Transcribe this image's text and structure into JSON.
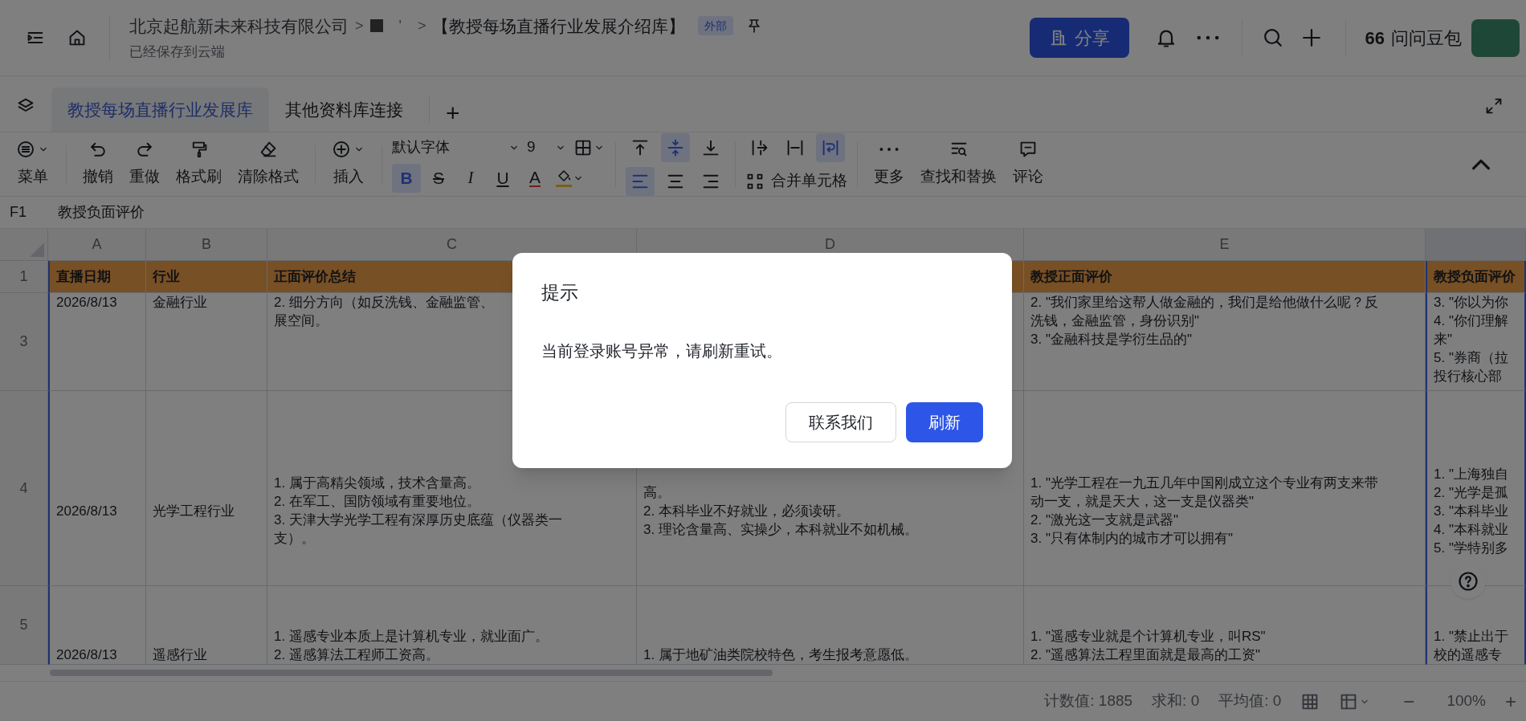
{
  "header": {
    "org": "北京起航新未来科技有限公司",
    "separators": [
      ">",
      ">"
    ],
    "hidden_segment": "'",
    "doc_title": "【教授每场直播行业发展介绍库】",
    "badge": "外部",
    "save_status": "已经保存到云端",
    "share_button": "分享",
    "assistant": {
      "mark": "66",
      "label": "问问豆包"
    }
  },
  "tabs": [
    {
      "label": "教授每场直播行业发展库",
      "selected": true
    },
    {
      "label": "其他资料库连接",
      "selected": false
    }
  ],
  "add_tab": "+",
  "toolbar": {
    "actions": [
      {
        "label": "菜单",
        "dropdown": true
      },
      {
        "label": "撤销",
        "dropdown": false
      },
      {
        "label": "重做",
        "dropdown": false
      },
      {
        "label": "格式刷",
        "dropdown": false
      },
      {
        "label": "清除格式",
        "dropdown": false
      },
      {
        "label": "插入",
        "dropdown": true
      }
    ],
    "font": "默认字体",
    "size": "9",
    "text_styles": [
      {
        "label": "B",
        "active": true
      },
      {
        "label": "S",
        "active": false
      },
      {
        "label": "I",
        "active": false
      },
      {
        "label": "U",
        "active": false
      },
      {
        "label": "A",
        "active": false
      }
    ],
    "vertical_align": [
      {
        "active": false
      },
      {
        "active": true
      },
      {
        "active": false
      }
    ],
    "horizontal_align": [
      {
        "active": true
      },
      {
        "active": false
      },
      {
        "active": false
      }
    ],
    "wrap_modes": [
      {
        "active": false
      },
      {
        "active": false
      },
      {
        "active": true
      }
    ],
    "merge": "合并单元格",
    "tools": [
      {
        "label": "更多"
      },
      {
        "label": "查找和替换"
      },
      {
        "label": "评论"
      }
    ]
  },
  "formula_bar": {
    "cell_ref": "F1",
    "value": "教授负面评价"
  },
  "sheet": {
    "columns": [
      {
        "letter": "A",
        "selected": false
      },
      {
        "letter": "B",
        "selected": false
      },
      {
        "letter": "C",
        "selected": false
      },
      {
        "letter": "D",
        "selected": false
      },
      {
        "letter": "E",
        "selected": false
      },
      {
        "selected": true
      }
    ],
    "rows": [
      {
        "number": "1",
        "kind": "header",
        "cells": [
          [
            "直播日期"
          ],
          [
            "行业"
          ],
          [
            "正面评价总结"
          ],
          null,
          [
            "教授正面评价"
          ],
          [
            "教授负面评价"
          ]
        ]
      },
      {
        "number": "3",
        "kind": "data",
        "cells": [
          [
            "2026/8/13"
          ],
          [
            "金融行业"
          ],
          [
            "2. 细分方向（如反洗钱、金融监管、",
            "展空间。"
          ],
          null,
          [
            "2. \"我们家里给这帮人做金融的，我们是给他做什么呢？反",
            "洗钱，金融监管，身份识别\"",
            "3. \"金融科技是学衍生品的\""
          ],
          [
            "3. \"你以为你",
            "4. \"你们理解",
            "来\"",
            "5. \"券商（拉",
            "投行核心部"
          ]
        ]
      },
      {
        "number": "4",
        "kind": "data",
        "cells": [
          [
            "2026/8/13"
          ],
          [
            "光学工程行业"
          ],
          [
            "1. 属于高精尖领域，技术含量高。",
            "2. 在军工、国防领域有重要地位。",
            "3. 天津大学光学工程有深厚历史底蕴（仪器类一",
            "支）。"
          ],
          [
            "高。",
            "2. 本科毕业不好就业，必须读研。",
            "3. 理论含量高、实操少，本科就业不如机械。"
          ],
          [
            "1. \"光学工程在一九五几年中国刚成立这个专业有两支来带",
            "动一支，就是天大，这一支是仪器类\"",
            "2. \"激光这一支就是武器\"",
            "3. \"只有体制内的城市才可以拥有\""
          ],
          [
            "1. \"上海独自",
            "2. \"光学是孤",
            "3. \"本科毕业",
            "4. \"本科就业",
            "5. \"学特别多"
          ]
        ]
      },
      {
        "number": "5",
        "kind": "data",
        "cells": [
          [
            "2026/8/13"
          ],
          [
            "遥感行业"
          ],
          [
            "1. 遥感专业本质上是计算机专业，就业面广。",
            "2. 遥感算法工程师工资高。"
          ],
          [
            "1. 属于地矿油类院校特色，考生报考意愿低。"
          ],
          [
            "1. \"遥感专业就是个计算机专业，叫RS\"",
            "2. \"遥感算法工程里面就是最高的工资\""
          ],
          [
            "1. \"禁止出于",
            "校的遥感专"
          ]
        ]
      }
    ]
  },
  "status_bar": {
    "count": "计数值: 1885",
    "sum": "求和: 0",
    "average": "平均值: 0",
    "zoom": "100%",
    "zoom_out": "−",
    "zoom_in": "+"
  },
  "dialog": {
    "title": "提示",
    "message": "当前登录账号异常，请刷新重试。",
    "buttons": [
      {
        "label": "联系我们",
        "kind": "secondary"
      },
      {
        "label": "刷新",
        "kind": "primary"
      }
    ]
  }
}
